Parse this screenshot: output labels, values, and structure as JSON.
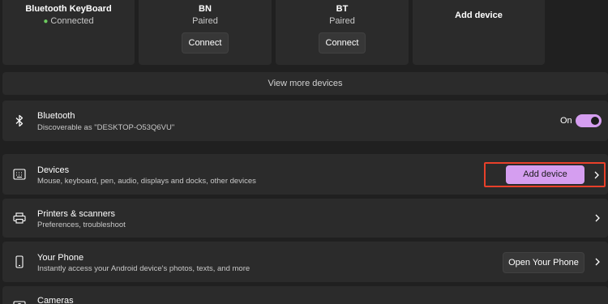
{
  "device_tiles": [
    {
      "name": "Bluetooth KeyBoard",
      "status": "Connected",
      "connected": true
    },
    {
      "name": "BN",
      "status": "Paired",
      "action": "Connect"
    },
    {
      "name": "BT",
      "status": "Paired",
      "action": "Connect"
    }
  ],
  "add_tile": {
    "label": "Add device",
    "icon": "plus-icon"
  },
  "view_more": "View more devices",
  "bluetooth": {
    "title": "Bluetooth",
    "subtitle": "Discoverable as \"DESKTOP-O53Q6VU\"",
    "toggle_label": "On",
    "toggle_on": true,
    "icon": "bluetooth-icon"
  },
  "devices": {
    "title": "Devices",
    "subtitle": "Mouse, keyboard, pen, audio, displays and docks, other devices",
    "button": "Add device",
    "icon": "keyboard-icon"
  },
  "printers": {
    "title": "Printers & scanners",
    "subtitle": "Preferences, troubleshoot",
    "icon": "printer-icon"
  },
  "your_phone": {
    "title": "Your Phone",
    "subtitle": "Instantly access your Android device's photos, texts, and more",
    "button": "Open Your Phone",
    "icon": "phone-icon"
  },
  "cameras": {
    "title": "Cameras",
    "icon": "camera-icon"
  },
  "colors": {
    "accent": "#d59ef0",
    "highlight": "#e8402a",
    "connected_dot": "#6ccb5f"
  }
}
